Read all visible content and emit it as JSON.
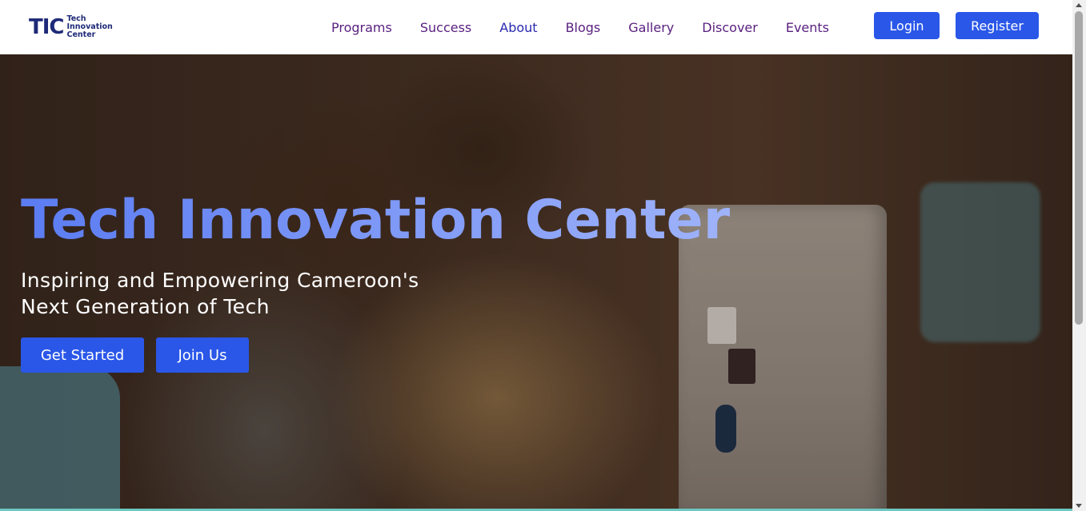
{
  "brand": {
    "mark": "TIC",
    "name_lines": [
      "Tech",
      "Innovation",
      "Center"
    ]
  },
  "nav": {
    "links": [
      "Programs",
      "Success",
      "About",
      "Blogs",
      "Gallery",
      "Discover",
      "Events"
    ],
    "active": "About"
  },
  "auth": {
    "login_label": "Login",
    "register_label": "Register"
  },
  "hero": {
    "title": "Tech Innovation Center",
    "subtitle": "Inspiring and Empowering Cameroon's Next Generation of Tech",
    "primary_cta": "Get Started",
    "secondary_cta": "Join Us"
  },
  "colors": {
    "accent": "#2a57e8",
    "nav_text": "#5a2180",
    "title_gradient_start": "#5b7cf2",
    "title_gradient_end": "#9fb3fa"
  }
}
